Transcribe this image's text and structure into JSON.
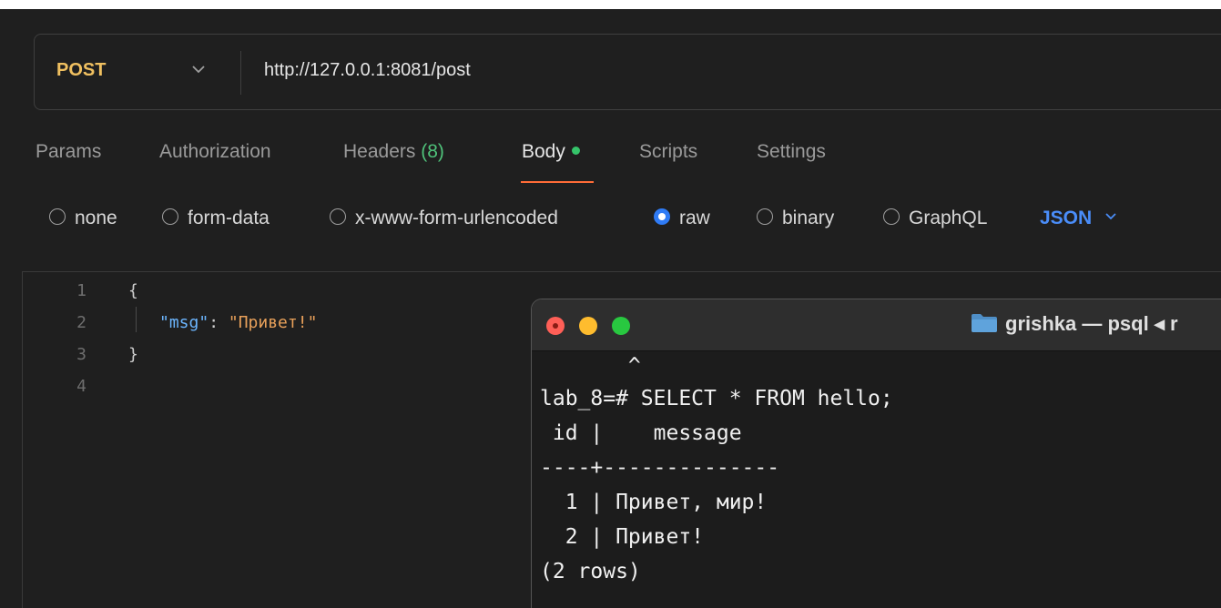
{
  "request": {
    "method": "POST",
    "url": "http://127.0.0.1:8081/post"
  },
  "tabs": [
    {
      "label": "Params"
    },
    {
      "label": "Authorization"
    },
    {
      "label": "Headers",
      "count": "(8)"
    },
    {
      "label": "Body",
      "active": true
    },
    {
      "label": "Scripts"
    },
    {
      "label": "Settings"
    }
  ],
  "body_types": {
    "options": [
      {
        "label": "none",
        "checked": false
      },
      {
        "label": "form-data",
        "checked": false
      },
      {
        "label": "x-www-form-urlencoded",
        "checked": false
      },
      {
        "label": "raw",
        "checked": true
      },
      {
        "label": "binary",
        "checked": false
      },
      {
        "label": "GraphQL",
        "checked": false
      }
    ],
    "language": "JSON"
  },
  "editor": {
    "line_numbers": [
      "1",
      "2",
      "3",
      "4"
    ],
    "lines": {
      "open_brace": "{",
      "key": "\"msg\"",
      "colon": ": ",
      "value": "\"Привет!\"",
      "close_brace": "}"
    }
  },
  "terminal": {
    "title": "grishka — psql ◂ r",
    "lines": [
      "       ^",
      "lab_8=# SELECT * FROM hello;",
      " id |    message",
      "----+--------------",
      "  1 | Привет, мир!",
      "  2 | Привет!",
      "(2 rows)"
    ]
  },
  "colors": {
    "accent_underline": "#ff6c37",
    "method": "#f0c060",
    "link_blue": "#4a8df8",
    "status_green": "#35c46a"
  }
}
